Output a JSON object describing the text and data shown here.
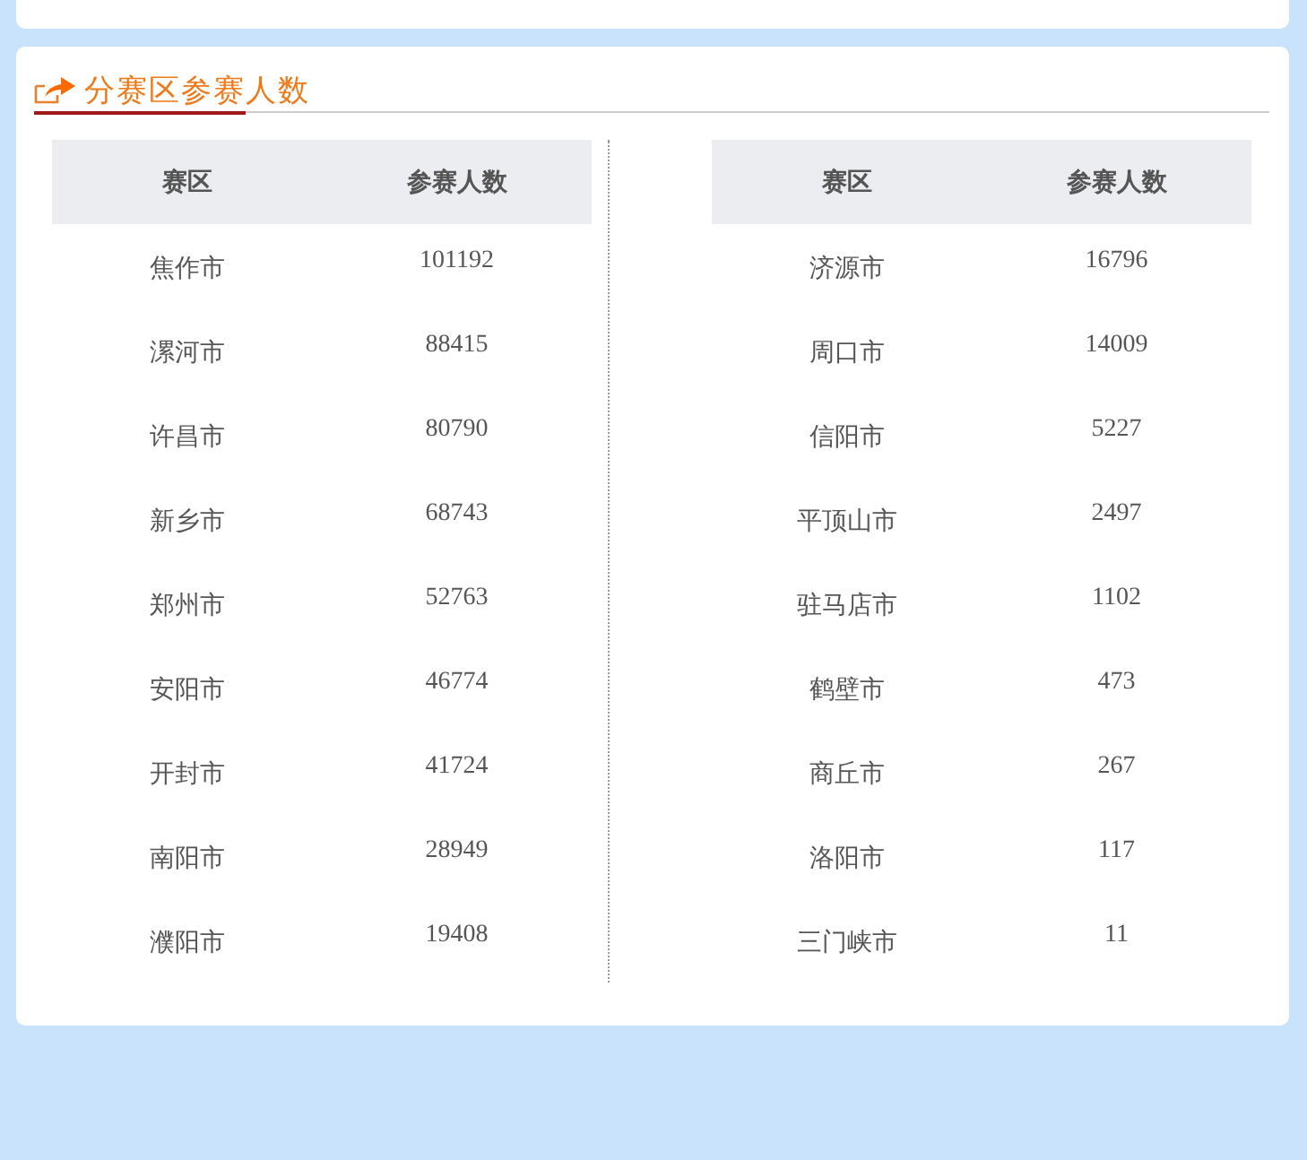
{
  "title": "分赛区参赛人数",
  "tables": [
    {
      "columns": [
        "赛区",
        "参赛人数"
      ],
      "rows": [
        [
          "焦作市",
          "101192"
        ],
        [
          "漯河市",
          "88415"
        ],
        [
          "许昌市",
          "80790"
        ],
        [
          "新乡市",
          "68743"
        ],
        [
          "郑州市",
          "52763"
        ],
        [
          "安阳市",
          "46774"
        ],
        [
          "开封市",
          "41724"
        ],
        [
          "南阳市",
          "28949"
        ],
        [
          "濮阳市",
          "19408"
        ]
      ]
    },
    {
      "columns": [
        "赛区",
        "参赛人数"
      ],
      "rows": [
        [
          "济源市",
          "16796"
        ],
        [
          "周口市",
          "14009"
        ],
        [
          "信阳市",
          "5227"
        ],
        [
          "平顶山市",
          "2497"
        ],
        [
          "驻马店市",
          "1102"
        ],
        [
          "鹤壁市",
          "473"
        ],
        [
          "商丘市",
          "267"
        ],
        [
          "洛阳市",
          "117"
        ],
        [
          "三门峡市",
          "11"
        ]
      ]
    }
  ]
}
